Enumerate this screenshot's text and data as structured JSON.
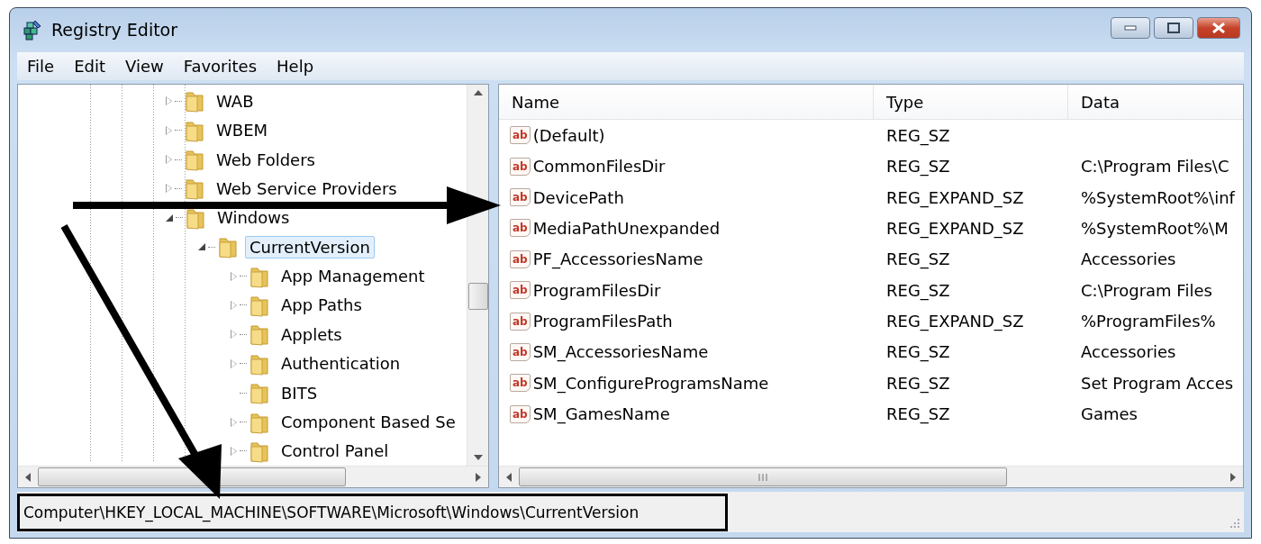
{
  "window": {
    "title": "Registry Editor"
  },
  "menu": [
    "File",
    "Edit",
    "View",
    "Favorites",
    "Help"
  ],
  "tree": [
    {
      "label": "WAB",
      "kind": "branch",
      "expanded": false,
      "selected": false
    },
    {
      "label": "WBEM",
      "kind": "branch",
      "expanded": false,
      "selected": false
    },
    {
      "label": "Web Folders",
      "kind": "branch",
      "expanded": false,
      "selected": false
    },
    {
      "label": "Web Service Providers",
      "kind": "branch",
      "expanded": false,
      "selected": false
    },
    {
      "label": "Windows",
      "kind": "branch",
      "expanded": true,
      "selected": false,
      "children": [
        {
          "label": "CurrentVersion",
          "kind": "branch",
          "expanded": true,
          "selected": true,
          "children": [
            {
              "label": "App Management",
              "kind": "branch",
              "expanded": false,
              "selected": false
            },
            {
              "label": "App Paths",
              "kind": "branch",
              "expanded": false,
              "selected": false
            },
            {
              "label": "Applets",
              "kind": "branch",
              "expanded": false,
              "selected": false
            },
            {
              "label": "Authentication",
              "kind": "branch",
              "expanded": false,
              "selected": false
            },
            {
              "label": "BITS",
              "kind": "leaf",
              "selected": false
            },
            {
              "label": "Component Based Se",
              "kind": "branch",
              "expanded": false,
              "selected": false
            },
            {
              "label": "Control Panel",
              "kind": "branch",
              "expanded": false,
              "selected": false
            }
          ]
        }
      ]
    }
  ],
  "values": {
    "columns": [
      "Name",
      "Type",
      "Data"
    ],
    "rows": [
      {
        "icon": "ab",
        "name": "(Default)",
        "type": "REG_SZ"
      },
      {
        "icon": "ab",
        "name": "CommonFilesDir",
        "type": "REG_SZ",
        "data": "C:\\Program Files\\C"
      },
      {
        "icon": "ab",
        "name": "DevicePath",
        "type": "REG_EXPAND_SZ",
        "data": "%SystemRoot%\\inf"
      },
      {
        "icon": "ab",
        "name": "MediaPathUnexpanded",
        "type": "REG_EXPAND_SZ",
        "data": "%SystemRoot%\\M"
      },
      {
        "icon": "ab",
        "name": "PF_AccessoriesName",
        "type": "REG_SZ",
        "data": "Accessories"
      },
      {
        "icon": "ab",
        "name": "ProgramFilesDir",
        "type": "REG_SZ",
        "data": "C:\\Program Files"
      },
      {
        "icon": "ab",
        "name": "ProgramFilesPath",
        "type": "REG_EXPAND_SZ",
        "data": "%ProgramFiles%"
      },
      {
        "icon": "ab",
        "name": "SM_AccessoriesName",
        "type": "REG_SZ",
        "data": "Accessories"
      },
      {
        "icon": "ab",
        "name": "SM_ConfigureProgramsName",
        "type": "REG_SZ",
        "data": "Set Program Acces"
      },
      {
        "icon": "ab",
        "name": "SM_GamesName",
        "type": "REG_SZ",
        "data": "Games"
      }
    ]
  },
  "status_bar": "Computer\\HKEY_LOCAL_MACHINE\\SOFTWARE\\Microsoft\\Windows\\CurrentVersion"
}
